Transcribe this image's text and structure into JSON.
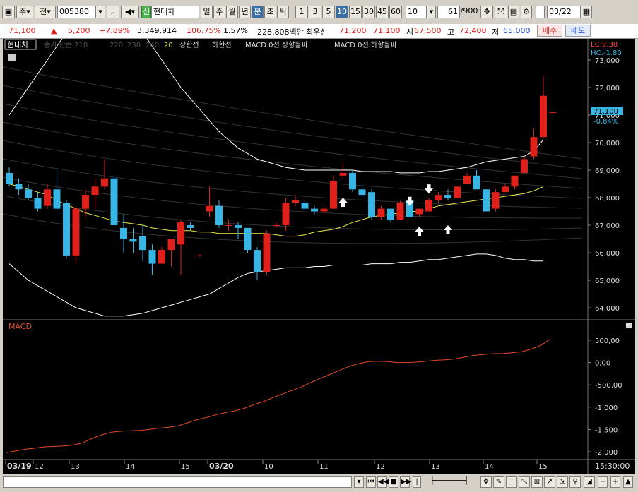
{
  "toolbar": {
    "mode_label": "주",
    "prev_label": "전",
    "code": "005380",
    "market_badge": "신",
    "stock_name": "현대차",
    "period_tabs": [
      "일",
      "주",
      "월",
      "년",
      "분",
      "초",
      "틱"
    ],
    "interval_tabs": [
      "1",
      "3",
      "5",
      "10",
      "15",
      "30",
      "45",
      "60"
    ],
    "interval_value": "10",
    "count_value": "61",
    "count_total": "/900",
    "date_value": "03/22"
  },
  "quote": {
    "price": "71,100",
    "direction": "▲",
    "change": "5,200",
    "change_pct": "+7.89%",
    "volume": "3,349,914",
    "volume_ratio": "106.75%",
    "turnover": "1.57%",
    "amount": "228,808백만",
    "preferred_label": "최우선",
    "ask": "71,200",
    "bid": "71,100",
    "open_label": "시",
    "open": "67,500",
    "high_label": "고",
    "high": "72,400",
    "low_label": "저",
    "low": "65,000",
    "buy_label": "매수",
    "sell_label": "매도"
  },
  "chart": {
    "legend_name": "현대차",
    "legend_items": [
      "종가 단순 210",
      "220",
      "230",
      "240",
      "20",
      "상한선",
      "하한선",
      "MACD 0선 상향돌파",
      "MACD 0선 하향돌파"
    ],
    "lc_label": "LC:9.38",
    "hc_label": "HC:-1.80",
    "current_price_tag": "71,100",
    "current_pct_tag": "-0.84%",
    "price_ticks": [
      "73,000",
      "72,000",
      "71,000",
      "70,000",
      "69,000",
      "68,000",
      "67,000",
      "66,000",
      "65,000",
      "64,000"
    ],
    "macd_label": "MACD",
    "macd_ticks": [
      "500,00",
      "0,00",
      "-500,00",
      "-1,000",
      "-1,500",
      "-2,000"
    ],
    "time_labels": [
      "03/19",
      "12",
      "13",
      "14",
      "15",
      "03/20",
      "10",
      "11",
      "12",
      "13",
      "14",
      "15"
    ],
    "time_end": "15:30:00"
  },
  "colors": {
    "up": "#e0201b",
    "down": "#37b5e5",
    "ma20": "#e8e84a",
    "band": "#ffffff",
    "macd": "#e04a2a",
    "background": "#000000"
  },
  "chart_data": {
    "type": "candlestick",
    "interval": "10 minutes",
    "candles": [
      {
        "o": 68900,
        "h": 69100,
        "l": 68400,
        "c": 68500
      },
      {
        "o": 68500,
        "h": 68700,
        "l": 68100,
        "c": 68300
      },
      {
        "o": 68300,
        "h": 68500,
        "l": 67900,
        "c": 68000
      },
      {
        "o": 68000,
        "h": 68200,
        "l": 67500,
        "c": 67600
      },
      {
        "o": 67700,
        "h": 68500,
        "l": 67600,
        "c": 68300
      },
      {
        "o": 68300,
        "h": 69000,
        "l": 67500,
        "c": 67600
      },
      {
        "o": 67800,
        "h": 67900,
        "l": 65800,
        "c": 65900
      },
      {
        "o": 65900,
        "h": 67700,
        "l": 65600,
        "c": 67600
      },
      {
        "o": 67600,
        "h": 68300,
        "l": 67300,
        "c": 68100
      },
      {
        "o": 68100,
        "h": 68700,
        "l": 67600,
        "c": 68400
      },
      {
        "o": 68400,
        "h": 69400,
        "l": 68300,
        "c": 68700
      },
      {
        "o": 68700,
        "h": 68800,
        "l": 67500,
        "c": 67000
      },
      {
        "o": 66900,
        "h": 67400,
        "l": 66000,
        "c": 66500
      },
      {
        "o": 66500,
        "h": 66900,
        "l": 66000,
        "c": 66400
      },
      {
        "o": 66600,
        "h": 67000,
        "l": 65700,
        "c": 66100
      },
      {
        "o": 66100,
        "h": 66300,
        "l": 65200,
        "c": 65600
      },
      {
        "o": 65600,
        "h": 66200,
        "l": 65600,
        "c": 66100
      },
      {
        "o": 66100,
        "h": 66500,
        "l": 65500,
        "c": 66500
      },
      {
        "o": 66300,
        "h": 67200,
        "l": 65200,
        "c": 67100
      },
      {
        "o": 67000,
        "h": 67100,
        "l": 66800,
        "c": 66900
      },
      {
        "o": 65900,
        "h": 65950,
        "l": 65850,
        "c": 65900
      },
      {
        "o": 67500,
        "h": 68400,
        "l": 67300,
        "c": 67700
      },
      {
        "o": 67700,
        "h": 67900,
        "l": 66900,
        "c": 67000
      },
      {
        "o": 67000,
        "h": 67200,
        "l": 66800,
        "c": 67000
      },
      {
        "o": 67000,
        "h": 67100,
        "l": 66500,
        "c": 66900
      },
      {
        "o": 66900,
        "h": 66900,
        "l": 66000,
        "c": 66100
      },
      {
        "o": 66100,
        "h": 66200,
        "l": 65000,
        "c": 65300
      },
      {
        "o": 65300,
        "h": 66800,
        "l": 65200,
        "c": 66700
      },
      {
        "o": 67000,
        "h": 67100,
        "l": 66900,
        "c": 67000
      },
      {
        "o": 67000,
        "h": 68000,
        "l": 66800,
        "c": 67800
      },
      {
        "o": 67800,
        "h": 68100,
        "l": 67700,
        "c": 67900
      },
      {
        "o": 67800,
        "h": 67900,
        "l": 67500,
        "c": 67600
      },
      {
        "o": 67600,
        "h": 67700,
        "l": 67400,
        "c": 67500
      },
      {
        "o": 67500,
        "h": 67700,
        "l": 67400,
        "c": 67600
      },
      {
        "o": 67600,
        "h": 68800,
        "l": 67600,
        "c": 68600
      },
      {
        "o": 68800,
        "h": 69300,
        "l": 68700,
        "c": 68900
      },
      {
        "o": 68900,
        "h": 69000,
        "l": 68200,
        "c": 68300
      },
      {
        "o": 68300,
        "h": 68500,
        "l": 68000,
        "c": 68100
      },
      {
        "o": 68200,
        "h": 68300,
        "l": 67200,
        "c": 67300
      },
      {
        "o": 67300,
        "h": 67700,
        "l": 67200,
        "c": 67600
      },
      {
        "o": 67600,
        "h": 67600,
        "l": 67100,
        "c": 67200
      },
      {
        "o": 67200,
        "h": 67900,
        "l": 67200,
        "c": 67800
      },
      {
        "o": 67900,
        "h": 67900,
        "l": 67300,
        "c": 67300
      },
      {
        "o": 67400,
        "h": 67600,
        "l": 67300,
        "c": 67600
      },
      {
        "o": 67500,
        "h": 68000,
        "l": 67500,
        "c": 67900
      },
      {
        "o": 67900,
        "h": 68200,
        "l": 67800,
        "c": 68100
      },
      {
        "o": 68100,
        "h": 68300,
        "l": 67900,
        "c": 68000
      },
      {
        "o": 68000,
        "h": 68400,
        "l": 68000,
        "c": 68400
      },
      {
        "o": 68500,
        "h": 68900,
        "l": 68500,
        "c": 68800
      },
      {
        "o": 68800,
        "h": 69000,
        "l": 68300,
        "c": 68300
      },
      {
        "o": 68300,
        "h": 68300,
        "l": 67500,
        "c": 67500
      },
      {
        "o": 67600,
        "h": 68300,
        "l": 67500,
        "c": 68200
      },
      {
        "o": 68200,
        "h": 68500,
        "l": 68200,
        "c": 68400
      },
      {
        "o": 68400,
        "h": 68800,
        "l": 68300,
        "c": 68800
      },
      {
        "o": 68900,
        "h": 69500,
        "l": 68900,
        "c": 69400
      },
      {
        "o": 69500,
        "h": 70500,
        "l": 69400,
        "c": 70200
      },
      {
        "o": 70200,
        "h": 72400,
        "l": 70200,
        "c": 71700
      },
      {
        "o": 71100,
        "h": 71150,
        "l": 71050,
        "c": 71100
      }
    ],
    "ma20": [
      68500,
      68400,
      68300,
      68200,
      68100,
      67900,
      67750,
      67600,
      67450,
      67350,
      67250,
      67150,
      67100,
      67050,
      67000,
      66900,
      66850,
      66800,
      66800,
      66800,
      66750,
      66750,
      66700,
      66700,
      66700,
      66700,
      66700,
      66700,
      66650,
      66600,
      66600,
      66650,
      66750,
      66800,
      66850,
      66950,
      67100,
      67200,
      67300,
      67350,
      67400,
      67450,
      67500,
      67500,
      67600,
      67700,
      67750,
      67800,
      67850,
      67900,
      67950,
      68000,
      68050,
      68100,
      68150,
      68250,
      68400
    ],
    "upper_band": [
      71000,
      71500,
      72000,
      72500,
      73000,
      73500,
      74000,
      74500,
      74800,
      75000,
      75200,
      75300,
      75000,
      74500,
      74000,
      73500,
      73000,
      72500,
      72000,
      71600,
      71200,
      70800,
      70400,
      70100,
      69800,
      69600,
      69400,
      69300,
      69200,
      69100,
      69050,
      69000,
      69000,
      69000,
      69000,
      69000,
      69000,
      68950,
      68950,
      68950,
      68950,
      68900,
      68900,
      68900,
      68950,
      68950,
      69000,
      69050,
      69100,
      69200,
      69300,
      69350,
      69400,
      69450,
      69500,
      69700,
      70100
    ],
    "lower_band": [
      65600,
      65300,
      65000,
      64800,
      64600,
      64400,
      64200,
      64000,
      63900,
      63800,
      63700,
      63700,
      63700,
      63750,
      63800,
      63900,
      64000,
      64100,
      64200,
      64300,
      64400,
      64500,
      64700,
      64900,
      65100,
      65250,
      65300,
      65350,
      65400,
      65450,
      65450,
      65450,
      65500,
      65500,
      65550,
      65550,
      65550,
      65550,
      65600,
      65600,
      65600,
      65650,
      65650,
      65700,
      65750,
      65750,
      65800,
      65850,
      65900,
      65950,
      65950,
      65900,
      65800,
      65750,
      65750,
      65700,
      65700
    ],
    "macd": [
      -2020,
      -1980,
      -1940,
      -1920,
      -1890,
      -1880,
      -1870,
      -1850,
      -1800,
      -1700,
      -1620,
      -1560,
      -1540,
      -1530,
      -1520,
      -1500,
      -1470,
      -1450,
      -1420,
      -1350,
      -1280,
      -1230,
      -1170,
      -1120,
      -1080,
      -1020,
      -940,
      -870,
      -780,
      -700,
      -620,
      -540,
      -440,
      -350,
      -260,
      -170,
      -80,
      -20,
      20,
      30,
      20,
      0,
      0,
      10,
      30,
      50,
      60,
      80,
      120,
      160,
      180,
      200,
      200,
      220,
      240,
      300,
      380,
      520
    ]
  }
}
